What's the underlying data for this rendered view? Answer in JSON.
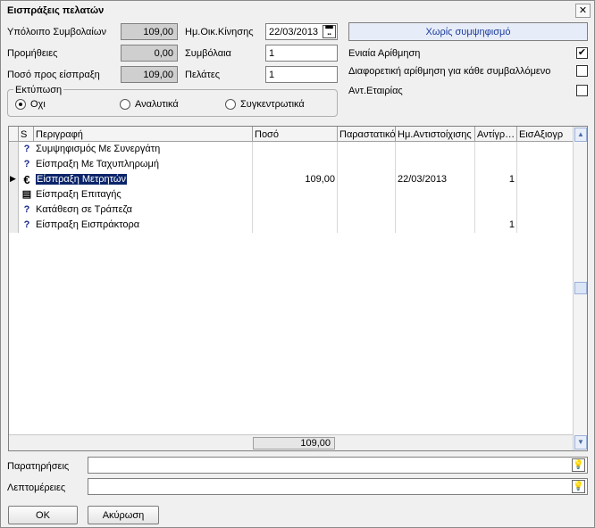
{
  "window": {
    "title": "Εισπράξεις πελατών",
    "close_label": "✕"
  },
  "form": {
    "ypoloipo_label": "Υπόλοιπο Συμβολαίων",
    "ypoloipo_value": "109,00",
    "promitheies_label": "Προμήθειες",
    "promitheies_value": "0,00",
    "poso_label": "Ποσό προς είσπραξη",
    "poso_value": "109,00",
    "date_label": "Ημ.Οικ.Κίνησης",
    "date_value": "22/03/2013",
    "symvolaia_label": "Συμβόλαια",
    "symvolaia_value": "1",
    "pelates_label": "Πελάτες",
    "pelates_value": "1",
    "info_text": "Χωρίς συμψηφισμό",
    "options": [
      {
        "label": "Ενιαία Αρίθμηση",
        "checked": true
      },
      {
        "label": "Διαφορετική αρίθμηση για κάθε συμβαλλόμενο",
        "checked": false
      },
      {
        "label": "Αντ.Εταιρίας",
        "checked": false
      }
    ],
    "check_mark": "✔",
    "ektiposi_label": "Εκτύπωση",
    "radios": [
      {
        "label": "Οχι",
        "selected": true
      },
      {
        "label": "Αναλυτικά",
        "selected": false
      },
      {
        "label": "Συγκεντρωτικά",
        "selected": false
      }
    ]
  },
  "grid": {
    "columns": [
      "S",
      "Περιγραφή",
      "Ποσό",
      "Παραστατικό",
      "Ημ.Αντιστοίχισης",
      "Αντίγρ…",
      "ΕισΑξιογρ"
    ],
    "rows": [
      {
        "icon": "?",
        "icon_name": "question-icon",
        "desc": "Συμψηφισμός Με Συνεργάτη",
        "amount": "",
        "doc": "",
        "date": "",
        "copies": ""
      },
      {
        "icon": "?",
        "icon_name": "question-icon",
        "desc": "Είσπραξη Με Ταχυπληρωμή",
        "amount": "",
        "doc": "",
        "date": "",
        "copies": ""
      },
      {
        "icon": "€",
        "icon_name": "euro-icon",
        "desc": "Είσπραξη Μετρητών",
        "amount": "109,00",
        "doc": "",
        "date": "22/03/2013",
        "copies": "1",
        "selected": true
      },
      {
        "icon": "▤",
        "icon_name": "cheque-icon",
        "desc": "Είσπραξη Επιταγής",
        "amount": "",
        "doc": "",
        "date": "",
        "copies": ""
      },
      {
        "icon": "?",
        "icon_name": "question-icon",
        "desc": "Κατάθεση σε Τράπεζα",
        "amount": "",
        "doc": "",
        "date": "",
        "copies": ""
      },
      {
        "icon": "?",
        "icon_name": "question-icon",
        "desc": "Είσπραξη Εισπράκτορα",
        "amount": "",
        "doc": "",
        "date": "",
        "copies": "1"
      }
    ],
    "row_pointer": "▶",
    "total": "109,00"
  },
  "bottom": {
    "paratiriseis_label": "Παρατηρήσεις",
    "paratiriseis_value": "",
    "leptomereies_label": "Λεπτομέρειες",
    "leptomereies_value": "",
    "ok_label": "OK",
    "cancel_label": "Ακύρωση",
    "bulb_glyph": "💡"
  },
  "scroll": {
    "up": "▲",
    "down": "▼"
  }
}
